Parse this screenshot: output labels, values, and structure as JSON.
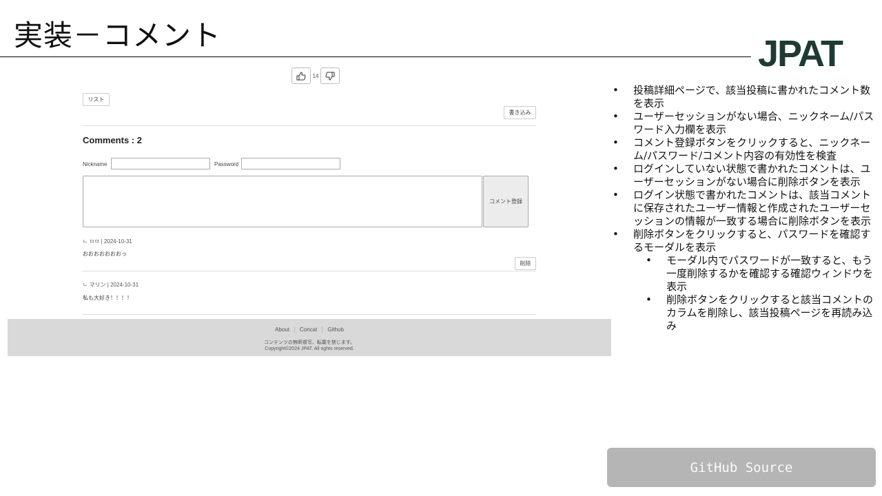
{
  "slide": {
    "title": "実装－コメント",
    "logo": "JPAT"
  },
  "screenshot": {
    "vote": {
      "like_icon": "thumbs-up-icon",
      "count": "14",
      "dislike_icon": "thumbs-down-icon"
    },
    "list_button": "リスト",
    "write_button": "書き込み",
    "comments_heading": "Comments : 2",
    "form": {
      "nickname_label": "Nickname",
      "nickname_value": "",
      "password_label": "Password",
      "password_value": "",
      "comment_value": "",
      "submit_label": "コメント登録"
    },
    "comments": [
      {
        "meta": "ㄴ ㅁㅁ | 2024-10-31",
        "body": "おおおおおおおっ",
        "delete_label": "削除"
      },
      {
        "meta": "ㄴ マリン | 2024-10-31",
        "body": "私も大好き！！！！"
      }
    ],
    "footer": {
      "links": [
        "About",
        "Concat",
        "Github"
      ],
      "notice": "コンテンツの無断複写、転載を禁じます。",
      "copyright": "Copyright©2024 JPAT. All rights reserved."
    }
  },
  "notes": [
    "投稿詳細ページで、該当投稿に書かれたコメント数を表示",
    "ユーザーセッションがない場合、ニックネーム/パスワード入力欄を表示",
    "コメント登録ボタンをクリックすると、ニックネーム/パスワード/コメント内容の有効性を検査",
    "ログインしていない状態で書かれたコメントは、ユーザーセッションがない場合に削除ボタンを表示",
    "ログイン状態で書かれたコメントは、該当コメントに保存されたユーザー情報と作成されたユーザーセッションの情報が一致する場合に削除ボタンを表示",
    "削除ボタンをクリックすると、パスワードを確認するモーダルを表示"
  ],
  "sub_notes": [
    "モーダル内でパスワードが一致すると、もう一度削除するかを確認する確認ウィンドウを表示",
    "削除ボタンをクリックすると該当コメントのカラムを削除し、該当投稿ページを再読み込み"
  ],
  "github_button": "GitHub Source"
}
